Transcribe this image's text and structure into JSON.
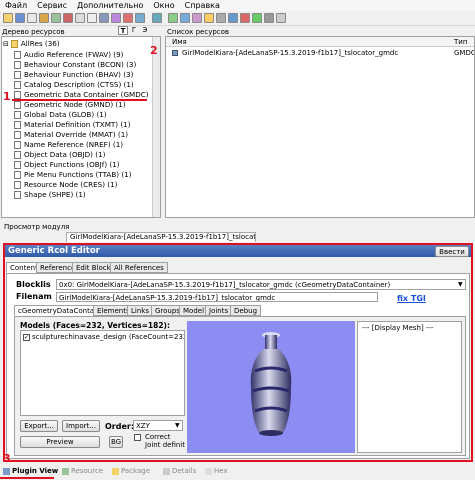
{
  "menu": [
    "Файл",
    "Сервис",
    "Дополнительно",
    "Окно",
    "Справка"
  ],
  "tree": {
    "header": "Дерево ресурсов",
    "mode_buttons": [
      "T",
      "Г",
      "Э"
    ],
    "root": "AllRes (36)",
    "items": [
      "Audio Reference (FWAV) (9)",
      "Behaviour Constant (BCON) (3)",
      "Behaviour Function (BHAV) (3)",
      "Catalog Description (CTSS) (1)",
      "Geometric Data Container (GMDC)",
      "Geometric Node (GMND) (1)",
      "Global Data (GLOB) (1)",
      "Material Definition (TXMT) (1)",
      "Material Override (MMAT) (1)",
      "Name Reference (NREF) (1)",
      "Object Data (OBJD) (1)",
      "Object Functions (OBJf) (1)",
      "Pie Menu Functions (TTAB) (1)",
      "Resource Node (CRES) (1)",
      "Shape (SHPE) (1)"
    ]
  },
  "list": {
    "header": "Список ресурсов",
    "col_name": "Имя",
    "col_type": "Тип",
    "row_name": "GirlModelKiara-[AdeLanaSP-15.3.2019-f1b17]_tslocator_gmdc",
    "row_type": "GMDC"
  },
  "preview": {
    "header": "Просмотр модуля",
    "tab": "GirlModelKiara-[AdeLanaSP-15.3.2019-f1b17]_tslocator_gmdc"
  },
  "editor": {
    "title": "Generic Rcol Editor",
    "commit": "Ввести",
    "tabs": [
      "Content",
      "Reference",
      "Edit Blocks",
      "All References"
    ],
    "blocklist_label": "Blocklis",
    "blocklist_value": "0x0: GirlModelKiara-[AdeLanaSP-15.3.2019-f1b17]_tslocator_gmdc (cGeometryDataContainer)",
    "filename_label": "Filenam",
    "filename_value": "GirlModelKiara-[AdeLanaSP-15.3.2019-f1b17]_tslocator_gmdc",
    "fix_tgi": "fix TGI",
    "subtabs": [
      "cGeometryDataContainer",
      "Elements",
      "Links",
      "Groups",
      "Model",
      "Joints",
      "Debug"
    ],
    "models_label": "Models (Faces=232, Vertices=182):",
    "model_item": "sculpturechinavase_design (FaceCount=232, Verti",
    "display_mesh": "--- [Display Mesh] ---",
    "export": "Export...",
    "import": "Import...",
    "order_label": "Order:",
    "order_value": "XZY",
    "preview_btn": "Preview",
    "bg_btn": "BG",
    "correct_label": "Correct",
    "joint_label": "Joint definit"
  },
  "bottom_tabs": [
    "Plugin View",
    "Resource",
    "Package",
    "Details",
    "Hex"
  ],
  "annotations": [
    "1",
    "2",
    "3"
  ]
}
